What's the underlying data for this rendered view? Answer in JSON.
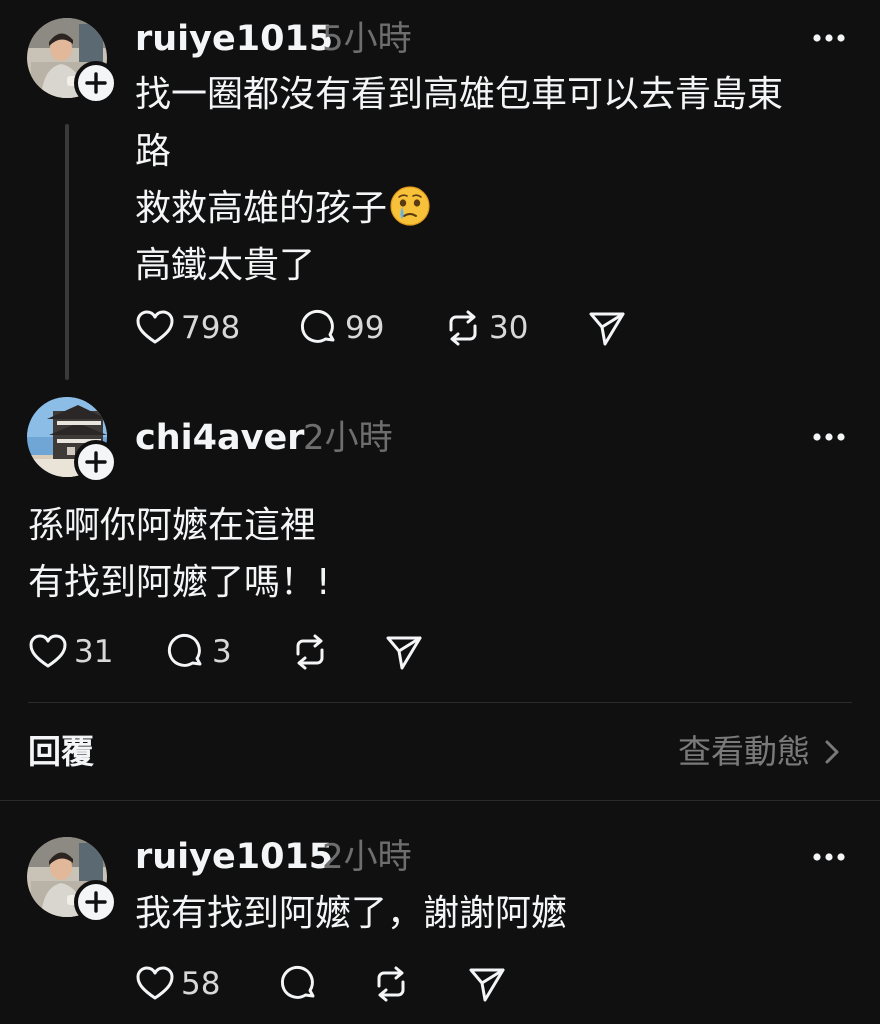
{
  "posts": [
    {
      "username": "ruiye1015",
      "time": "5小時",
      "lines": [
        "找一圈都沒有看到高雄包車可以去青島東",
        "路",
        "救救高雄的孩子",
        "高鐵太貴了"
      ],
      "emoji_after_line": 2,
      "emoji_name": "face-holding-back-tears-emoji",
      "likes": "798",
      "comments": "99",
      "reposts": "30"
    },
    {
      "username": "chi4aver",
      "time": "2小時",
      "lines": [
        "孫啊你阿嬤在這裡",
        "有找到阿嬤了嗎！!"
      ],
      "likes": "31",
      "comments": "3",
      "reposts": ""
    },
    {
      "username": "ruiye1015",
      "time": "2小時",
      "lines": [
        "我有找到阿嬤了，謝謝阿嬤"
      ],
      "likes": "58",
      "comments": "",
      "reposts": ""
    }
  ],
  "replies_section": {
    "title": "回覆",
    "view_activity": "查看動態"
  },
  "icons": {
    "like": "heart-icon",
    "comment": "comment-bubble-icon",
    "repost": "repost-icon",
    "share": "send-icon",
    "more": "more-options-icon",
    "follow": "plus-icon",
    "chevron": "chevron-right-icon"
  },
  "colors": {
    "background": "#101010",
    "primary_text": "#f3f5f7",
    "secondary_text": "#6e6e6e",
    "divider": "#2b2b2b"
  }
}
